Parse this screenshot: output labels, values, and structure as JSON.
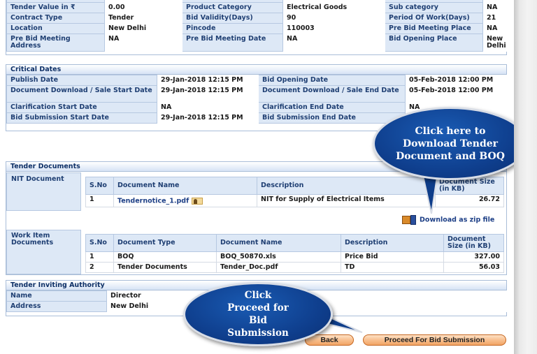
{
  "basic_details": {
    "rows": [
      [
        {
          "label": "Tender Value in ₹",
          "value": "0.00"
        },
        {
          "label": "Product Category",
          "value": "Electrical Goods"
        },
        {
          "label": "Sub category",
          "value": "NA"
        }
      ],
      [
        {
          "label": "Contract Type",
          "value": "Tender"
        },
        {
          "label": "Bid Validity(Days)",
          "value": "90"
        },
        {
          "label": "Period Of Work(Days)",
          "value": "21"
        }
      ],
      [
        {
          "label": "Location",
          "value": "New Delhi"
        },
        {
          "label": "Pincode",
          "value": "110003"
        },
        {
          "label": "Pre Bid Meeting Place",
          "value": "NA"
        }
      ],
      [
        {
          "label": "Pre Bid Meeting Address",
          "value": "NA"
        },
        {
          "label": "Pre Bid Meeting Date",
          "value": "NA"
        },
        {
          "label": "Bid Opening Place",
          "value": "New Delhi"
        }
      ]
    ]
  },
  "critical_dates": {
    "title": "Critical Dates",
    "rows": [
      [
        {
          "label": "Publish Date",
          "value": "29-Jan-2018 12:15 PM"
        },
        {
          "label": "Bid Opening Date",
          "value": "05-Feb-2018 12:00 PM"
        }
      ],
      [
        {
          "label": "Document Download / Sale Start Date",
          "value": "29-Jan-2018 12:15 PM"
        },
        {
          "label": "Document Download / Sale End Date",
          "value": "05-Feb-2018 12:00 PM"
        }
      ],
      [
        {
          "label": "Clarification Start Date",
          "value": "NA"
        },
        {
          "label": "Clarification End Date",
          "value": "NA"
        }
      ],
      [
        {
          "label": "Bid Submission Start Date",
          "value": "29-Jan-2018 12:15 PM"
        },
        {
          "label": "Bid Submission End Date",
          "value": ""
        }
      ]
    ]
  },
  "tender_documents": {
    "title": "Tender Documents",
    "nit": {
      "label": "NIT Document",
      "columns": [
        "S.No",
        "Document Name",
        "Description",
        "Document Size (in KB)"
      ],
      "rows": [
        {
          "sno": "1",
          "name": "Tendernotice_1.pdf",
          "description": "NIT for Supply of Electrical Items",
          "size": "26.72"
        }
      ]
    },
    "download_zip_label": "Download as zip file",
    "work_item": {
      "label": "Work Item Documents",
      "columns": [
        "S.No",
        "Document Type",
        "Document Name",
        "Description",
        "Document Size (in KB)"
      ],
      "rows": [
        {
          "sno": "1",
          "type": "BOQ",
          "name": "BOQ_50870.xls",
          "description": "Price Bid",
          "size": "327.00"
        },
        {
          "sno": "2",
          "type": "Tender Documents",
          "name": "Tender_Doc.pdf",
          "description": "TD",
          "size": "56.03"
        }
      ]
    }
  },
  "authority": {
    "title": "Tender Inviting Authority",
    "rows": [
      {
        "label": "Name",
        "value": "Director"
      },
      {
        "label": "Address",
        "value": "New Delhi"
      }
    ]
  },
  "callouts": {
    "download": "Click here to Download  Tender Document and BOQ",
    "proceed": "Click Proceed for Bid Submission"
  },
  "buttons": {
    "back": "Back",
    "proceed": "Proceed For Bid Submission"
  }
}
